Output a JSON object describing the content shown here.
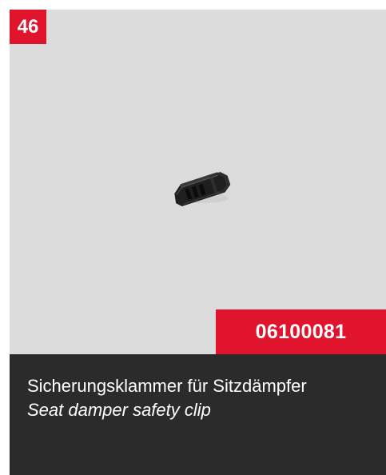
{
  "card": {
    "item_number": "46",
    "part_number": "06100081",
    "title_de": "Sicherungsklammer für Sitzdämpfer",
    "title_en": "Seat damper safety clip",
    "image": {
      "icon": "safety-clip-image"
    }
  },
  "colors": {
    "accent": "#e1142d",
    "image_background": "#dcdcdc",
    "text_panel_background": "#2b2b2b",
    "text": "#ffffff"
  }
}
